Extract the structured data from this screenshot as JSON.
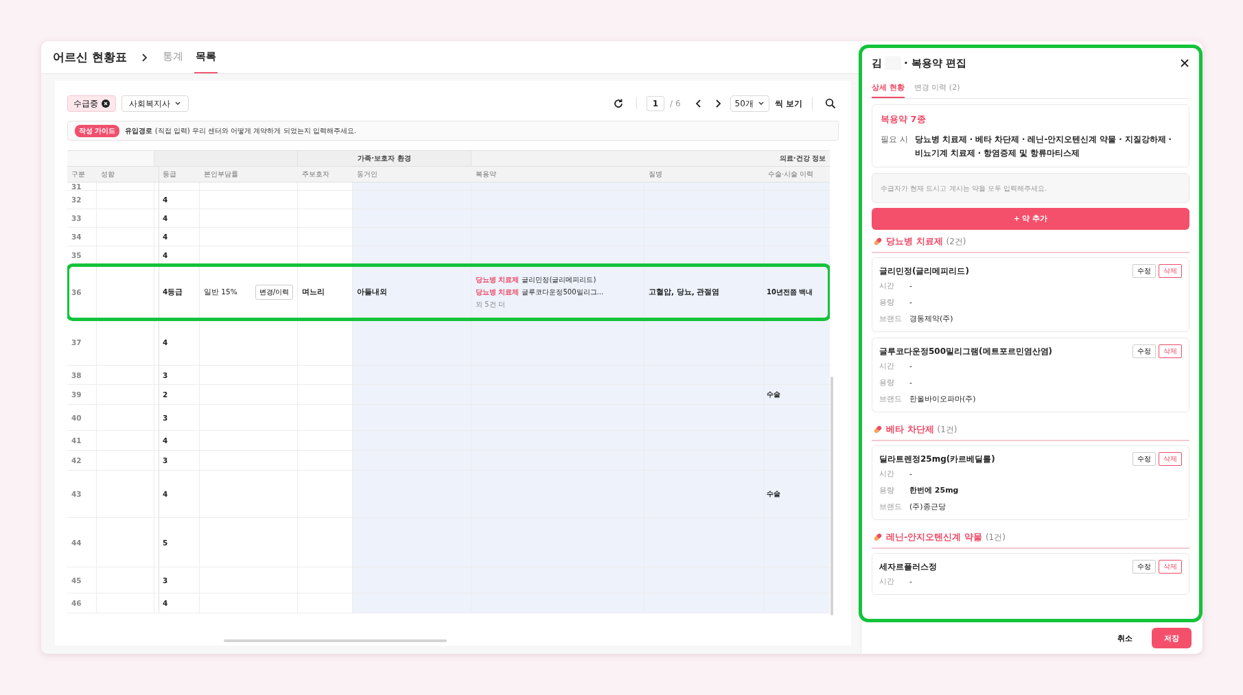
{
  "header": {
    "title": "어르신 현황표",
    "tabs": [
      {
        "label": "통계",
        "selected": false
      },
      {
        "label": "목록",
        "selected": true
      }
    ]
  },
  "toolbar": {
    "filters": [
      {
        "kind": "chip",
        "label": "수급중"
      },
      {
        "kind": "dropdown",
        "label": "사회복지사"
      }
    ],
    "page": "1",
    "total": "/ 6",
    "page_size": "50개",
    "page_size_suffix": "씩 보기"
  },
  "guide": {
    "badge": "작성 가이드",
    "text": "**유입경로** (직접 입력) 우리 센터와 어떻게 계약하게 되었는지 입력해주세요."
  },
  "table": {
    "groups": [
      {
        "columns": [
          "구분",
          "성함"
        ]
      },
      {
        "columns": [
          "등급",
          "본인부담률"
        ]
      },
      {
        "label": "가족·보호자 환경",
        "columns": [
          "주보호자",
          "동거인"
        ]
      },
      {
        "label": "의료·건강 정보",
        "columns": [
          "복용약",
          "질병",
          "수술·시술 이력"
        ]
      }
    ],
    "rows": [
      {
        "no": "31",
        "highlight": false
      },
      {
        "no": "32",
        "grade": "4",
        "highlight": false
      },
      {
        "no": "33",
        "grade": "4",
        "highlight": false
      },
      {
        "no": "34",
        "grade": "4",
        "highlight": false
      },
      {
        "no": "35",
        "grade": "4",
        "highlight": false
      },
      {
        "no": "36",
        "grade": "4등급",
        "copay": "일반 15%",
        "copay_button": "변경/이력",
        "caregiver": "며느리",
        "cohabitant": "아들내외",
        "meds": [
          {
            "tag": "당뇨병 치료제",
            "name": "글리민정(글리메피리드)"
          },
          {
            "tag": "당뇨병 치료제",
            "name": "글루코다운정500밀리그..."
          }
        ],
        "meds_more": "외 5건 더",
        "disease": "고혈압, 당뇨, 관절염",
        "surgery": "10년전쯤 백내",
        "highlight": true
      },
      {
        "no": "37",
        "grade": "4",
        "highlight": false
      },
      {
        "no": "38",
        "grade": "3",
        "highlight": false
      },
      {
        "no": "39",
        "grade": "2",
        "surgery": "수술",
        "highlight": false
      },
      {
        "no": "40",
        "grade": "3",
        "highlight": false
      },
      {
        "no": "41",
        "grade": "4",
        "highlight": false
      },
      {
        "no": "42",
        "grade": "3",
        "highlight": false
      },
      {
        "no": "43",
        "grade": "4",
        "surgery": "수술",
        "highlight": false
      },
      {
        "no": "44",
        "grade": "5",
        "highlight": false
      },
      {
        "no": "45",
        "grade": "3",
        "highlight": false
      },
      {
        "no": "46",
        "grade": "4",
        "highlight": false
      }
    ]
  },
  "drawer": {
    "highlight": true,
    "surname": "김",
    "title": "· 복용약 편집",
    "tabs": [
      {
        "label": "상세 현황",
        "selected": true
      },
      {
        "label": "변경 이력 (2)",
        "selected": false
      }
    ],
    "summary": {
      "title": "복용약 7종",
      "label": "필요 시",
      "text": "당뇨병 치료제 · 베타 차단제 · 레닌-안지오텐신계 약물 · 지질강하제 · 비뇨기계 치료제 · 항염증제 및 항류마티스제"
    },
    "input": {
      "placeholder": "수급자가 현재 드시고 계시는 약을 모두 입력해주세요."
    },
    "add_button": "+ 약 추가",
    "categories": [
      {
        "name": "당뇨병 치료제",
        "count": "(2건)",
        "drugs": [
          {
            "name": "글리민정(글리메피리드)",
            "edit": "수정",
            "delete": "삭제",
            "fields": [
              {
                "label": "시간",
                "value": "-",
                "bold": false
              },
              {
                "label": "용량",
                "value": "-",
                "bold": false
              },
              {
                "label": "브랜드",
                "value": "경동제약(주)",
                "bold": false
              }
            ]
          },
          {
            "name": "글루코다운정500밀리그램(메트포르민염산염)",
            "edit": "수정",
            "delete": "삭제",
            "fields": [
              {
                "label": "시간",
                "value": "-",
                "bold": false
              },
              {
                "label": "용량",
                "value": "-",
                "bold": false
              },
              {
                "label": "브랜드",
                "value": "한올바이오파마(주)",
                "bold": false
              }
            ]
          }
        ]
      },
      {
        "name": "베타 차단제",
        "count": "(1건)",
        "drugs": [
          {
            "name": "딜라트렌정25mg(카르베딜롤)",
            "edit": "수정",
            "delete": "삭제",
            "fields": [
              {
                "label": "시간",
                "value": "-",
                "bold": false
              },
              {
                "label": "용량",
                "value": "한번에 25mg",
                "bold": true
              },
              {
                "label": "브랜드",
                "value": "(주)종근당",
                "bold": false
              }
            ]
          }
        ]
      },
      {
        "name": "레닌-안지오텐신계 약물",
        "count": "(1건)",
        "drugs": [
          {
            "name": "세자르플러스정",
            "edit": "수정",
            "delete": "삭제",
            "fields": [
              {
                "label": "시간",
                "value": "-",
                "bold": false
              }
            ]
          }
        ]
      }
    ],
    "cancel": "취소",
    "save": "저장"
  }
}
